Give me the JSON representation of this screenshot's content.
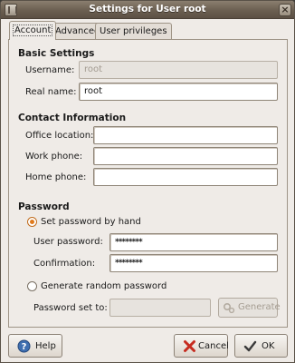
{
  "window": {
    "title": "Settings for User root",
    "close_glyph": "×"
  },
  "tabs": [
    {
      "label": "Account",
      "active": true
    },
    {
      "label": "Advanced",
      "active": false
    },
    {
      "label": "User privileges",
      "active": false
    }
  ],
  "basic": {
    "heading": "Basic Settings",
    "username_label": "Username:",
    "username_value": "root",
    "realname_label": "Real name:",
    "realname_value": "root"
  },
  "contact": {
    "heading": "Contact Information",
    "office_label": "Office location:",
    "office_value": "",
    "work_label": "Work phone:",
    "work_value": "",
    "home_label": "Home phone:",
    "home_value": ""
  },
  "password": {
    "heading": "Password",
    "set_by_hand_label": "Set password by hand",
    "set_by_hand_selected": true,
    "user_password_label": "User password:",
    "user_password_value": "********",
    "confirmation_label": "Confirmation:",
    "confirmation_value": "********",
    "generate_random_label": "Generate random password",
    "generate_random_selected": false,
    "password_set_to_label": "Password set to:",
    "password_set_to_value": "",
    "generate_button_label": "Generate"
  },
  "buttons": {
    "help": "Help",
    "cancel": "Cancel",
    "ok": "OK"
  },
  "colors": {
    "radio_accent": "#e07a1c",
    "titlebar": "#6b5f51",
    "cancel_icon": "#c62c20",
    "ok_icon": "#3a3a3a"
  }
}
